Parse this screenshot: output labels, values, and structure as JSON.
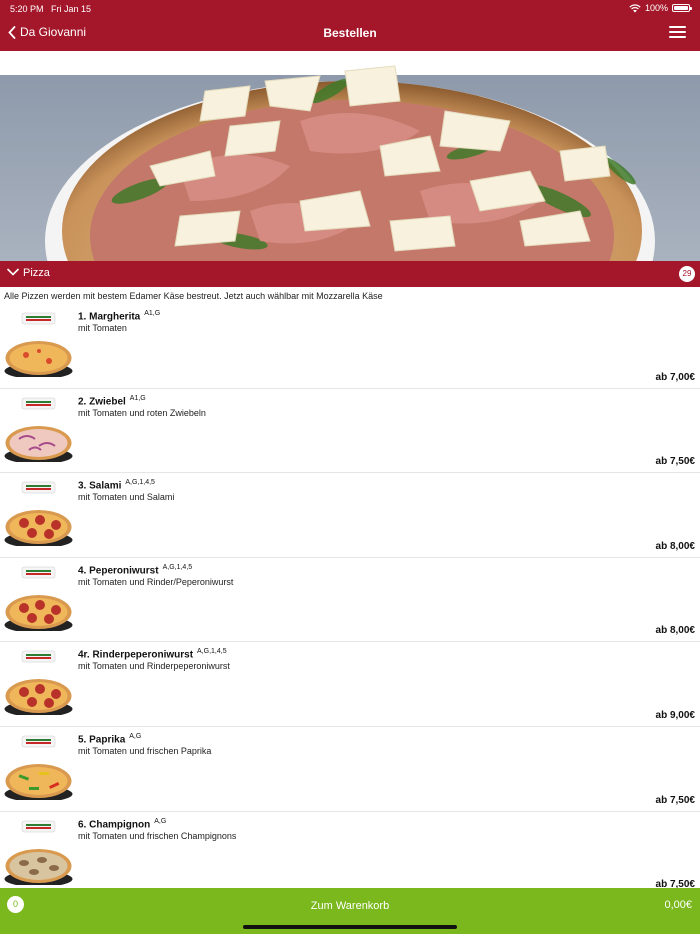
{
  "status": {
    "time": "5:20 PM",
    "date": "Fri Jan 15",
    "battery": "100%"
  },
  "nav": {
    "back_label": "Da Giovanni",
    "title": "Bestellen"
  },
  "category": {
    "label": "Pizza",
    "count": "29",
    "note": "Alle Pizzen werden mit bestem Edamer Käse bestreut. Jetzt auch wählbar mit Mozzarella Käse"
  },
  "items": [
    {
      "name": "1. Margherita",
      "allergens": "A1,G",
      "desc": "mit Tomaten",
      "price": "ab 7,00€",
      "topping": "margherita"
    },
    {
      "name": "2. Zwiebel",
      "allergens": "A1,G",
      "desc": "mit Tomaten und roten Zwiebeln",
      "price": "ab 7,50€",
      "topping": "onion"
    },
    {
      "name": "3. Salami",
      "allergens": "A,G,1,4,5",
      "desc": "mit Tomaten und Salami",
      "price": "ab 8,00€",
      "topping": "salami"
    },
    {
      "name": "4. Peperoniwurst",
      "allergens": "A,G,1,4,5",
      "desc": "mit Tomaten und Rinder/Peperoniwurst",
      "price": "ab 8,00€",
      "topping": "salami"
    },
    {
      "name": "4r. Rinderpeperoniwurst",
      "allergens": "A,G,1,4,5",
      "desc": "mit Tomaten und Rinderpeperoniwurst",
      "price": "ab 9,00€",
      "topping": "salami"
    },
    {
      "name": "5. Paprika",
      "allergens": "A,G",
      "desc": "mit Tomaten und frischen Paprika",
      "price": "ab 7,50€",
      "topping": "paprika"
    },
    {
      "name": "6. Champignon",
      "allergens": "A,G",
      "desc": "mit Tomaten und frischen Champignons",
      "price": "ab 7,50€",
      "topping": "mushroom"
    }
  ],
  "footer": {
    "cart_count": "0",
    "cart_label": "Zum Warenkorb",
    "total": "0,00€"
  },
  "colors": {
    "brand_red": "#a4172a",
    "cart_green": "#7ab81d"
  }
}
